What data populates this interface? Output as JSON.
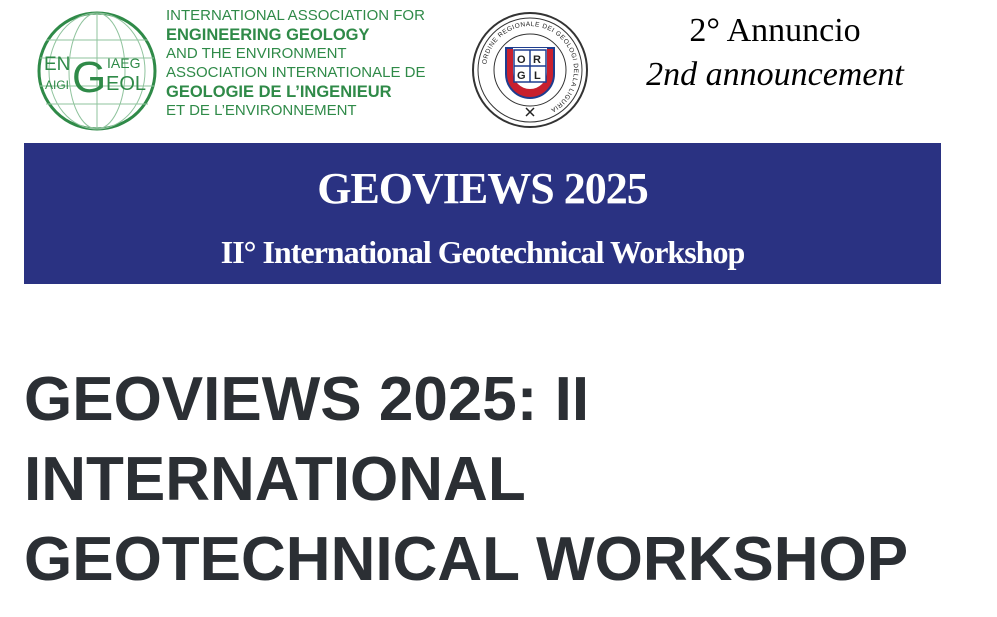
{
  "header": {
    "iaeg": {
      "logo_text": {
        "en": "EN",
        "aigi": "AIGI",
        "g": "G",
        "iaeg": "IAEG",
        "eol": "EOL"
      },
      "lines": [
        {
          "text": "INTERNATIONAL ASSOCIATION FOR",
          "style": "thin"
        },
        {
          "text": "ENGINEERING GEOLOGY",
          "style": "bold"
        },
        {
          "text": "AND THE ENVIRONMENT",
          "style": "thin"
        },
        {
          "text": "ASSOCIATION INTERNATIONALE DE",
          "style": "thin"
        },
        {
          "text": "GEOLOGIE DE L’INGENIEUR",
          "style": "bold"
        },
        {
          "text": "ET DE L’ENVIRONNEMENT",
          "style": "thin"
        }
      ],
      "color": "#2f8a48"
    },
    "orgl": {
      "letters": [
        "O",
        "R",
        "G",
        "L"
      ],
      "ring_text": "ORDINE REGIONALE DEI GEOLOGI DELLA LIGURIA",
      "color_red": "#c8202e",
      "color_blue": "#1e3d8f"
    },
    "announcement": {
      "italian": "2° Annuncio",
      "english": "2nd announcement"
    }
  },
  "banner": {
    "title": "GEOVIEWS 2025",
    "subtitle": "II° International Geotechnical Workshop",
    "background": "#2a3282"
  },
  "main": {
    "title_lines": [
      "GEOVIEWS 2025: II",
      "INTERNATIONAL",
      "GEOTECHNICAL WORKSHOP"
    ]
  }
}
